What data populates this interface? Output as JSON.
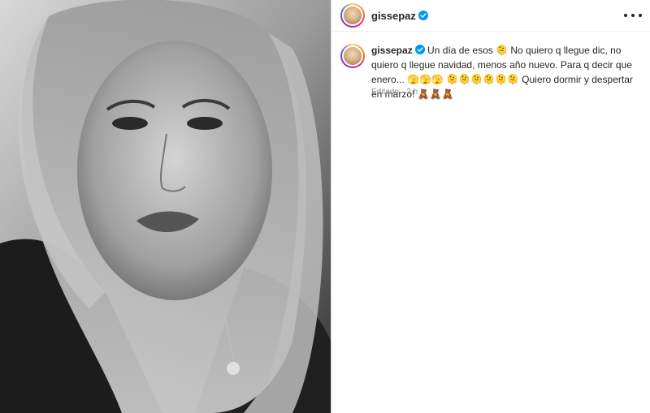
{
  "post": {
    "username": "gissepaz",
    "caption_user": "gissepaz",
    "caption_text": "Un día de esos 🫠 No quiero q llegue dic, no quiero q llegue navidad, menos año nuevo. Para q decir que enero... 🫣🫣🫣 🫠🫠🫠🫠🫠🫠 Quiero dormir y despertar en marzo! 🧸🧸🧸",
    "edited_label": "Editado",
    "separator": "·",
    "time_ago": "2 h"
  },
  "icons": {
    "verified": "verified-badge-icon",
    "more": "more-options-icon"
  },
  "colors": {
    "verified_blue": "#0095f6",
    "meta_gray": "#8e8e8e",
    "text": "#262626"
  }
}
